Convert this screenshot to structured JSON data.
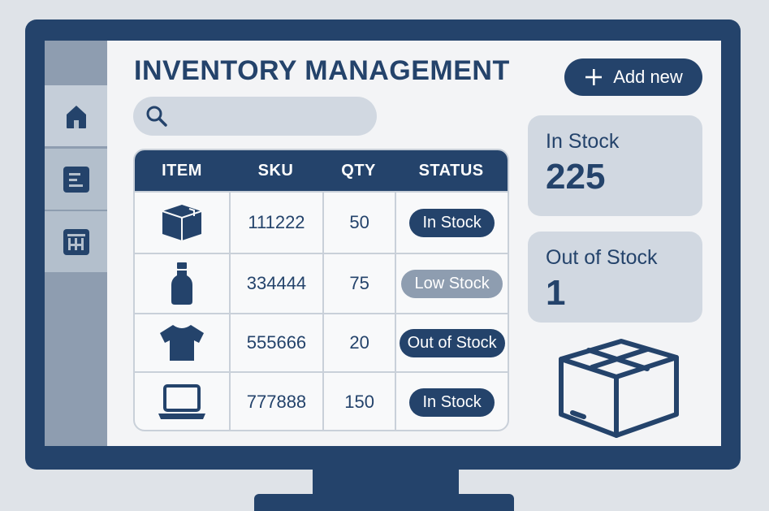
{
  "app": {
    "title": "INVENTORY MANAGEMENT",
    "add_button_label": "Add new"
  },
  "search": {
    "placeholder": ""
  },
  "sidebar": {
    "items": [
      {
        "name": "home",
        "icon": "home-icon"
      },
      {
        "name": "list",
        "icon": "list-icon"
      },
      {
        "name": "warehouse",
        "icon": "warehouse-icon"
      }
    ]
  },
  "table": {
    "headers": [
      "ITEM",
      "SKU",
      "QTY",
      "STATUS"
    ],
    "rows": [
      {
        "icon": "box-icon",
        "sku": "111222",
        "qty": "50",
        "status": "In Stock"
      },
      {
        "icon": "bottle-icon",
        "sku": "334444",
        "qty": "75",
        "status": "Low Stock"
      },
      {
        "icon": "tshirt-icon",
        "sku": "555666",
        "qty": "20",
        "status": "Out of Stock"
      },
      {
        "icon": "laptop-icon",
        "sku": "777888",
        "qty": "150",
        "status": "In Stock"
      }
    ]
  },
  "summary": {
    "in_stock": {
      "label": "In Stock",
      "value": "225"
    },
    "out_of_stock": {
      "label": "Out of Stock",
      "value": "1"
    }
  },
  "colors": {
    "primary": "#24436b",
    "sidebar": "#8e9db0",
    "card": "#d1d8e1",
    "low_stock": "#8e9db0"
  }
}
